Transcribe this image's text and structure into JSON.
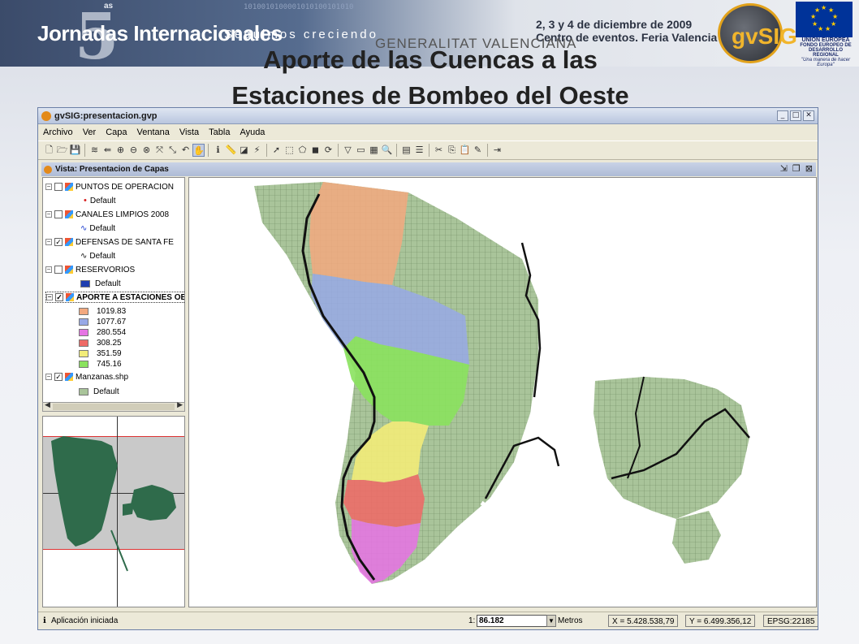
{
  "banner": {
    "title": "Jornadas Internacionales",
    "subtitle": "Seguimos creciendo",
    "edition_num": "5",
    "edition_suffix": "as",
    "binary": "1010010100001010100101010",
    "event_date": "2, 3 y 4 de diciembre de 2009",
    "event_place": "Centro de eventos. Feria Valencia",
    "generalitat": "GENERALITAT VALENCIANA",
    "gvsig_logo": "gvSIG",
    "eu_name": "UNIÓN EUROPEA",
    "eu_fund": "FONDO EUROPEO DE DESARROLLO REGIONAL",
    "eu_motto": "\"Una manera de hacer Europa\""
  },
  "slide": {
    "title_line1": "Aporte de las Cuencas a las",
    "title_line2": "Estaciones de Bombeo del Oeste"
  },
  "app": {
    "title": "gvSIG:presentacion.gvp",
    "window_buttons": [
      "_",
      "□",
      "✕"
    ],
    "menu": [
      "Archivo",
      "Ver",
      "Capa",
      "Ventana",
      "Vista",
      "Tabla",
      "Ayuda"
    ],
    "view_title": "Vista: Presentacion de Capas",
    "view_buttons": [
      "⇲",
      "❐",
      "⊠"
    ]
  },
  "toc": {
    "layers": [
      {
        "name": "PUNTOS DE OPERACION",
        "checked": false,
        "legend": [
          {
            "label": "Default",
            "symbol": "point-red",
            "color": "#d81e1e"
          }
        ]
      },
      {
        "name": "CANALES LIMPIOS 2008",
        "checked": false,
        "legend": [
          {
            "label": "Default",
            "symbol": "line-blue",
            "color": "#1a3ccf"
          }
        ]
      },
      {
        "name": "DEFENSAS DE SANTA FE",
        "checked": true,
        "legend": [
          {
            "label": "Default",
            "symbol": "line-black",
            "color": "#111111"
          }
        ]
      },
      {
        "name": "RESERVORIOS",
        "checked": false,
        "legend": [
          {
            "label": "Default",
            "symbol": "fill",
            "color": "#1f3fb0"
          }
        ]
      },
      {
        "name": "APORTE A ESTACIONES OES",
        "checked": true,
        "legend": [
          {
            "label": "1019.83",
            "symbol": "fill",
            "color": "#f3a97f"
          },
          {
            "label": "1077.67",
            "symbol": "fill",
            "color": "#98a9e6"
          },
          {
            "label": "280.554",
            "symbol": "fill",
            "color": "#e574e3"
          },
          {
            "label": "308.25",
            "symbol": "fill",
            "color": "#ee6a66"
          },
          {
            "label": "351.59",
            "symbol": "fill",
            "color": "#f2ec79"
          },
          {
            "label": "745.16",
            "symbol": "fill",
            "color": "#8ae25e"
          }
        ]
      },
      {
        "name": "Manzanas.shp",
        "checked": true,
        "legend": [
          {
            "label": "Default",
            "symbol": "fill",
            "color": "#a9c49a"
          }
        ]
      }
    ]
  },
  "status": {
    "message": "Aplicación iniciada",
    "scale_prefix": "1:",
    "scale_value": "86.182",
    "units": "Metros",
    "x": "X = 5.428.538,79",
    "y": "Y = 6.499.356,12",
    "epsg": "EPSG:22185"
  },
  "colors": {
    "block_fill": "#a9c49a",
    "locator_fill": "#2f6b4b"
  }
}
